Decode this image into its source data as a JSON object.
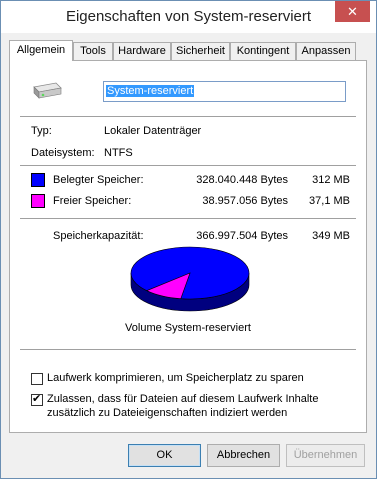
{
  "window": {
    "title": "Eigenschaften von System-reserviert",
    "close_glyph": "✕"
  },
  "tabs": [
    {
      "label": "Allgemein"
    },
    {
      "label": "Tools"
    },
    {
      "label": "Hardware"
    },
    {
      "label": "Sicherheit"
    },
    {
      "label": "Kontingent"
    },
    {
      "label": "Anpassen"
    }
  ],
  "general": {
    "volume_name": "System-reserviert",
    "type_label": "Typ:",
    "type_value": "Lokaler Datenträger",
    "fs_label": "Dateisystem:",
    "fs_value": "NTFS",
    "used": {
      "label": "Belegter Speicher:",
      "bytes": "328.040.448 Bytes",
      "short": "312 MB",
      "color": "#0000ff"
    },
    "free": {
      "label": "Freier Speicher:",
      "bytes": "38.957.056 Bytes",
      "short": "37,1 MB",
      "color": "#ff00ff"
    },
    "capacity": {
      "label": "Speicherkapazität:",
      "bytes": "366.997.504 Bytes",
      "short": "349 MB"
    },
    "pie_caption": "Volume System-reserviert",
    "used_fraction": 0.894,
    "compress_label": "Laufwerk komprimieren, um Speicherplatz zu sparen",
    "compress_checked": false,
    "index_label_line1": "Zulassen, dass für Dateien auf diesem Laufwerk Inhalte",
    "index_label_line2": "zusätzlich zu Dateieigenschaften indiziert werden",
    "index_checked": true
  },
  "buttons": {
    "ok": "OK",
    "cancel": "Abbrechen",
    "apply": "Übernehmen"
  },
  "icons": {
    "drive": "drive-icon",
    "close": "close-icon",
    "check": "checkmark-icon"
  }
}
